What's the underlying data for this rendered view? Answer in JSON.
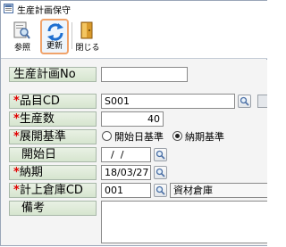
{
  "window": {
    "title": "生産計画保守"
  },
  "toolbar": {
    "buttons": [
      {
        "label": "参照",
        "icon": "document-lookup-icon"
      },
      {
        "label": "更新",
        "icon": "refresh-icon"
      },
      {
        "label": "閉じる",
        "icon": "exit-door-icon"
      }
    ]
  },
  "form": {
    "plan_no": {
      "label": "生産計画No",
      "value": ""
    },
    "item_cd": {
      "required_mark": "*",
      "label": "品目CD",
      "value": "S001"
    },
    "quantity": {
      "required_mark": "*",
      "label": "生産数",
      "value": "40"
    },
    "schedule_basis": {
      "required_mark": "*",
      "label": "展開基準",
      "options": [
        "開始日基準",
        "納期基準"
      ],
      "selected": "納期基準"
    },
    "start_date": {
      "label": "開始日",
      "value": "  /  /"
    },
    "due_date": {
      "required_mark": "*",
      "label": "納期",
      "value": "18/03/27"
    },
    "warehouse_cd": {
      "required_mark": "*",
      "label": "計上倉庫CD",
      "value": "001",
      "name": "資材倉庫"
    },
    "remarks": {
      "label": "備考",
      "value": ""
    }
  },
  "colors": {
    "required": "#e00000",
    "label_bg": "#dbe8d4",
    "selected_button_border": "#f0a36b"
  }
}
